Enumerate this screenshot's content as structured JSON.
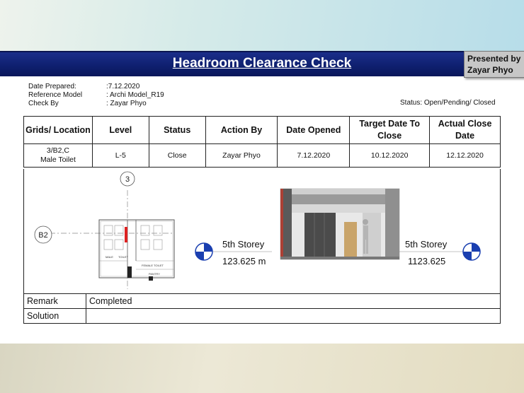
{
  "header": {
    "title": "Headroom Clearance Check",
    "presenter_label": "Presented by",
    "presenter_name": "Zayar Phyo"
  },
  "meta": {
    "date_prepared_label": "Date Prepared:",
    "date_prepared_value": ":7.12.2020",
    "reference_model_label": "Reference Model",
    "reference_model_value": ": Archi Model_R19",
    "check_by_label": "Check By",
    "check_by_value": ": Zayar Phyo",
    "status_legend": "Status: Open/Pending/ Closed"
  },
  "table": {
    "headers": [
      "Grids/ Location",
      "Level",
      "Status",
      "Action By",
      "Date Opened",
      "Target Date To Close",
      "Actual Close Date"
    ],
    "row": {
      "grids_line1": "3/B2,C",
      "grids_line2": "Male Toilet",
      "level": "L-5",
      "status": "Close",
      "action_by": "Zayar Phyo",
      "date_opened": "7.12.2020",
      "target_date": "10.12.2020",
      "actual_close": "12.12.2020"
    }
  },
  "drawing": {
    "grid_bubble_3": "3",
    "grid_bubble_b2": "B2",
    "plan_labels": {
      "male": "MALE",
      "toilet": "TOILET",
      "female_toilet": "FEMALE TOILET",
      "pantry": "PANTRY"
    },
    "left_level_name": "5th Storey",
    "left_level_value": "123.625 m",
    "right_level_name": "5th Storey",
    "right_level_value": "1123.625"
  },
  "remarks": {
    "remark_label": "Remark",
    "remark_value": "Completed",
    "solution_label": "Solution",
    "solution_value": ""
  },
  "colors": {
    "title_bar": "#0e1f6e",
    "level_marker": "#1a3fb0"
  }
}
